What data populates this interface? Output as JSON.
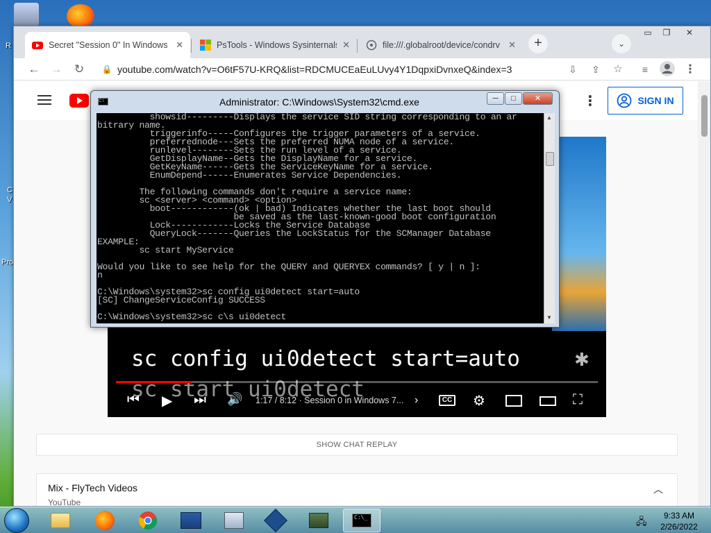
{
  "desktop": {
    "left_fragments": [
      "R",
      "C",
      "V",
      "Pro"
    ]
  },
  "chrome": {
    "tabs": [
      {
        "title": "Secret \"Session 0\" In Windows -",
        "favicon": "youtube-icon",
        "active": true
      },
      {
        "title": "PsTools - Windows Sysinternals |",
        "favicon": "windows-icon",
        "active": false
      },
      {
        "title": "file:///.globalroot/device/condrv",
        "favicon": "globe-icon",
        "active": false
      }
    ],
    "new_tab_label": "+",
    "url": "youtube.com/watch?v=O6tF57U-KRQ&list=RDCMUCEaEuLUvy4Y1DqpxiDvnxeQ&index=3"
  },
  "youtube": {
    "signin_label": "SIGN IN",
    "caption_line1": "sc config ui0detect start=auto",
    "caption_line2": "sc start ui0detect",
    "time_text": "1:17 / 8:12 · Session 0 in Windows 7...",
    "progress_fraction": 0.157,
    "show_chat_replay": "SHOW CHAT REPLAY",
    "mix_title": "Mix - FlyTech Videos",
    "mix_subtitle": "YouTube"
  },
  "cmd": {
    "title": "Administrator: C:\\Windows\\System32\\cmd.exe",
    "lines": [
      "          showsid---------Displays the service SID string corresponding to an ar",
      "bitrary name.",
      "          triggerinfo-----Configures the trigger parameters of a service.",
      "          preferrednode---Sets the preferred NUMA node of a service.",
      "          runlevel--------Sets the run level of a service.",
      "          GetDisplayName--Gets the DisplayName for a service.",
      "          GetKeyName------Gets the ServiceKeyName for a service.",
      "          EnumDepend------Enumerates Service Dependencies.",
      "",
      "        The following commands don't require a service name:",
      "        sc <server> <command> <option>",
      "          boot------------(ok | bad) Indicates whether the last boot should",
      "                          be saved as the last-known-good boot configuration",
      "          Lock------------Locks the Service Database",
      "          QueryLock-------Queries the LockStatus for the SCManager Database",
      "EXAMPLE:",
      "        sc start MyService",
      "",
      "Would you like to see help for the QUERY and QUERYEX commands? [ y | n ]:",
      "n",
      "",
      "C:\\Windows\\system32>sc config ui0detect start=auto",
      "[SC] ChangeServiceConfig SUCCESS",
      "",
      "C:\\Windows\\system32>sc c\\s ui0detect"
    ]
  },
  "taskbar": {
    "time": "9:33 AM",
    "date": "2/26/2022"
  }
}
